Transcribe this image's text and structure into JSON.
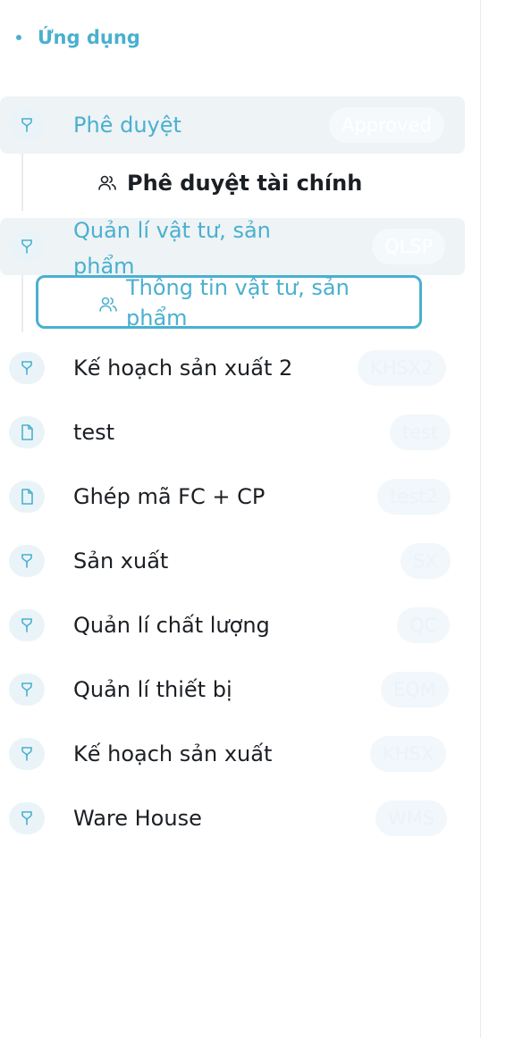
{
  "section": {
    "label": "Ứng dụng"
  },
  "items": [
    {
      "label": "Phê duyệt",
      "badge": "Approved",
      "icon": "git-branch-icon",
      "active": true
    },
    {
      "label": "Quản lí vật tư, sản phẩm",
      "badge": "QLSP",
      "icon": "git-branch-icon",
      "active": true
    },
    {
      "label": "Kế hoạch sản xuất 2",
      "badge": "KHSX2",
      "icon": "git-branch-icon"
    },
    {
      "label": "test",
      "badge": "test",
      "icon": "file-icon"
    },
    {
      "label": "Ghép mã FC + CP",
      "badge": "test2",
      "icon": "file-icon"
    },
    {
      "label": "Sản xuất",
      "badge": "SX",
      "icon": "git-branch-icon"
    },
    {
      "label": "Quản lí chất lượng",
      "badge": "QC",
      "icon": "git-branch-icon"
    },
    {
      "label": "Quản lí thiết bị",
      "badge": "EQM",
      "icon": "git-branch-icon"
    },
    {
      "label": "Kế hoạch sản xuất",
      "badge": "KHSX",
      "icon": "git-branch-icon"
    },
    {
      "label": "Ware House",
      "badge": "WMS",
      "icon": "git-branch-icon"
    }
  ],
  "children": {
    "approval": {
      "label": "Phê duyệt tài chính",
      "icon": "users-icon"
    },
    "materials": {
      "label": "Thông tin vật tư, sản phẩm",
      "icon": "users-icon"
    }
  },
  "colors": {
    "accent": "#4ab0cf",
    "active_bg": "#eef3f6",
    "icon_bg": "#eaf4f8"
  }
}
